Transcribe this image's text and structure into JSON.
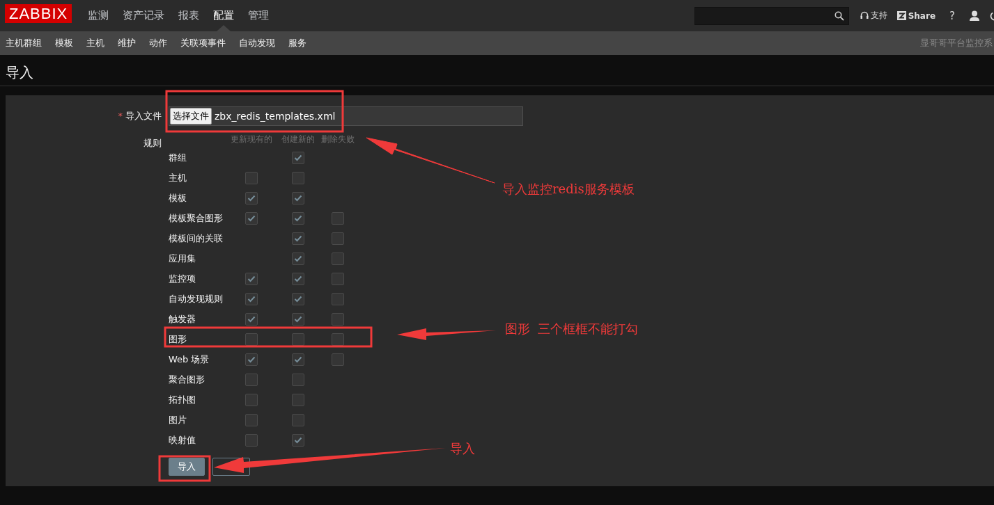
{
  "topbar": {
    "logo": "ZABBIX",
    "menu": [
      {
        "label": "监测",
        "selected": false
      },
      {
        "label": "资产记录",
        "selected": false
      },
      {
        "label": "报表",
        "selected": false
      },
      {
        "label": "配置",
        "selected": true
      },
      {
        "label": "管理",
        "selected": false
      }
    ],
    "support": "支持",
    "share": "Share",
    "help": "?"
  },
  "subnav": {
    "items": [
      "主机群组",
      "模板",
      "主机",
      "维护",
      "动作",
      "关联项事件",
      "自动发现",
      "服务"
    ],
    "server_name": "显哥哥平台监控系"
  },
  "page_title": "导入",
  "form": {
    "file_label": "导入文件",
    "required_mark": "*",
    "file_button": "选择文件",
    "file_name": "zbx_redis_templates.xml",
    "rules_label": "规则",
    "columns": [
      "更新现有的",
      "创建新的",
      "删除失败"
    ],
    "rows": [
      {
        "label": "群组",
        "cells": [
          {
            "kind": "none"
          },
          {
            "kind": "checkbox",
            "checked": true
          },
          {
            "kind": "none"
          }
        ]
      },
      {
        "label": "主机",
        "cells": [
          {
            "kind": "checkbox",
            "checked": false
          },
          {
            "kind": "checkbox",
            "checked": false
          },
          {
            "kind": "none"
          }
        ]
      },
      {
        "label": "模板",
        "cells": [
          {
            "kind": "checkbox",
            "checked": true
          },
          {
            "kind": "checkbox",
            "checked": true
          },
          {
            "kind": "none"
          }
        ]
      },
      {
        "label": "模板聚合图形",
        "cells": [
          {
            "kind": "checkbox",
            "checked": true
          },
          {
            "kind": "checkbox",
            "checked": true
          },
          {
            "kind": "checkbox",
            "checked": false
          }
        ]
      },
      {
        "label": "模板间的关联",
        "cells": [
          {
            "kind": "none"
          },
          {
            "kind": "checkbox",
            "checked": true
          },
          {
            "kind": "checkbox",
            "checked": false
          }
        ]
      },
      {
        "label": "应用集",
        "cells": [
          {
            "kind": "none"
          },
          {
            "kind": "checkbox",
            "checked": true
          },
          {
            "kind": "checkbox",
            "checked": false
          }
        ]
      },
      {
        "label": "监控项",
        "cells": [
          {
            "kind": "checkbox",
            "checked": true
          },
          {
            "kind": "checkbox",
            "checked": true
          },
          {
            "kind": "checkbox",
            "checked": false
          }
        ]
      },
      {
        "label": "自动发现规则",
        "cells": [
          {
            "kind": "checkbox",
            "checked": true
          },
          {
            "kind": "checkbox",
            "checked": true
          },
          {
            "kind": "checkbox",
            "checked": false
          }
        ]
      },
      {
        "label": "触发器",
        "cells": [
          {
            "kind": "checkbox",
            "checked": true
          },
          {
            "kind": "checkbox",
            "checked": true
          },
          {
            "kind": "checkbox",
            "checked": false
          }
        ]
      },
      {
        "label": "图形",
        "cells": [
          {
            "kind": "checkbox",
            "checked": false
          },
          {
            "kind": "checkbox",
            "checked": false
          },
          {
            "kind": "checkbox",
            "checked": false
          }
        ]
      },
      {
        "label": "Web 场景",
        "cells": [
          {
            "kind": "checkbox",
            "checked": true
          },
          {
            "kind": "checkbox",
            "checked": true
          },
          {
            "kind": "checkbox",
            "checked": false
          }
        ]
      },
      {
        "label": "聚合图形",
        "cells": [
          {
            "kind": "checkbox",
            "checked": false
          },
          {
            "kind": "checkbox",
            "checked": false
          },
          {
            "kind": "none"
          }
        ]
      },
      {
        "label": "拓扑图",
        "cells": [
          {
            "kind": "checkbox",
            "checked": false
          },
          {
            "kind": "checkbox",
            "checked": false
          },
          {
            "kind": "none"
          }
        ]
      },
      {
        "label": "图片",
        "cells": [
          {
            "kind": "checkbox",
            "checked": false
          },
          {
            "kind": "checkbox",
            "checked": false
          },
          {
            "kind": "none"
          }
        ]
      },
      {
        "label": "映射值",
        "cells": [
          {
            "kind": "checkbox",
            "checked": false
          },
          {
            "kind": "checkbox",
            "checked": true
          },
          {
            "kind": "none"
          }
        ]
      }
    ],
    "buttons": [
      {
        "label": "导入",
        "kind": "primary"
      },
      {
        "kind": "secondary"
      }
    ]
  },
  "annotations": [
    {
      "text": "导入监控redis服务模板"
    },
    {
      "text": "图形  三个框框不能打勾"
    },
    {
      "text": "导入"
    }
  ]
}
